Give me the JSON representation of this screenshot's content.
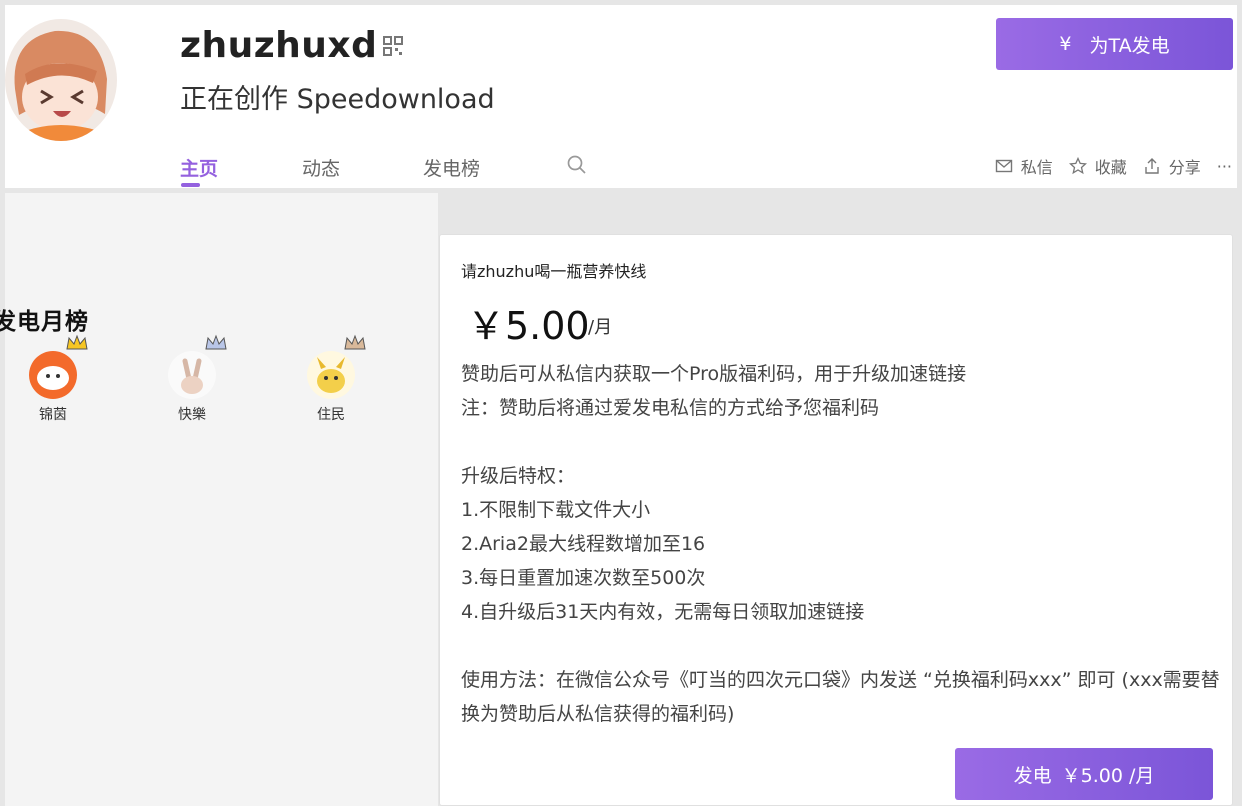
{
  "profile": {
    "name": "zhuzhuxd",
    "subtitle": "正在创作 Speedownload",
    "support_button": {
      "icon": "¥",
      "label": "为TA发电"
    }
  },
  "tabs": [
    {
      "label": "主页",
      "active": true
    },
    {
      "label": "动态",
      "active": false
    },
    {
      "label": "发电榜",
      "active": false
    }
  ],
  "actions": {
    "message": "私信",
    "favorite": "收藏",
    "share": "分享",
    "more": "···"
  },
  "ranking": {
    "title": "发电月榜",
    "supporters": [
      {
        "name": "锦茵"
      },
      {
        "name": "快樂"
      },
      {
        "name": "住民"
      }
    ]
  },
  "plan": {
    "title": "请zhuzhu喝一瓶营养快线",
    "price": "￥5.00",
    "price_unit": "/月",
    "description": [
      "赞助后可从私信内获取一个Pro版福利码，用于升级加速链接",
      "注：赞助后将通过爱发电私信的方式给予您福利码",
      "",
      "升级后特权：",
      "1.不限制下载文件大小",
      "2.Aria2最大线程数增加至16",
      "3.每日重置加速次数至500次",
      "4.自升级后31天内有效，无需每日领取加速链接",
      "",
      "使用方法：在微信公众号《叮当的四次元口袋》内发送 “兑换福利码xxx” 即可 (xxx需要替换为赞助后从私信获得的福利码)"
    ],
    "button": {
      "label": "发电",
      "price": "￥5.00 /月"
    }
  },
  "colors": {
    "accent": "#9461df",
    "button_start": "#9a6be5",
    "button_end": "#7b55d8"
  }
}
